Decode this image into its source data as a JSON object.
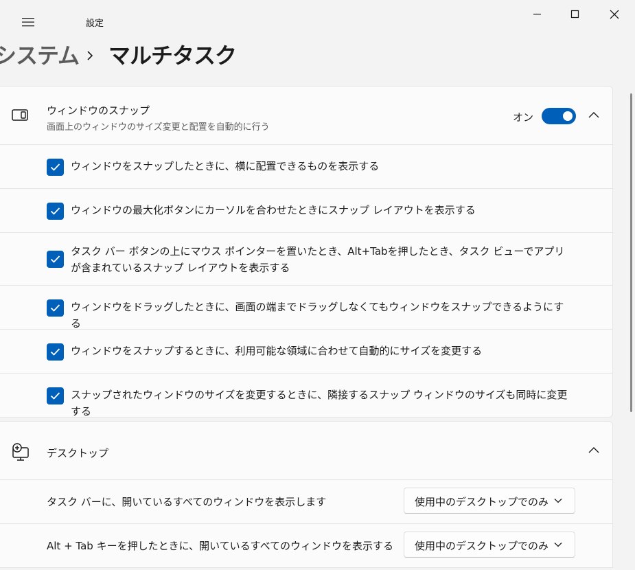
{
  "window": {
    "app_title": "設定"
  },
  "breadcrumb": {
    "parent": "システム",
    "separator": "›",
    "current": "マルチタスク"
  },
  "snap": {
    "title": "ウィンドウのスナップ",
    "subtitle": "画面上のウィンドウのサイズ変更と配置を自動的に行う",
    "toggle_label": "オン",
    "toggle_on": true,
    "options": [
      {
        "label": "ウィンドウをスナップしたときに、横に配置できるものを表示する",
        "checked": true
      },
      {
        "label": "ウィンドウの最大化ボタンにカーソルを合わせたときにスナップ レイアウトを表示する",
        "checked": true
      },
      {
        "label": "タスク バー ボタンの上にマウス ポインターを置いたとき、Alt+Tabを押したとき、タスク ビューでアプリが含まれているスナップ レイアウトを表示する",
        "checked": true
      },
      {
        "label": "ウィンドウをドラッグしたときに、画面の端までドラッグしなくてもウィンドウをスナップできるようにする",
        "checked": true
      },
      {
        "label": "ウィンドウをスナップするときに、利用可能な領域に合わせて自動的にサイズを変更する",
        "checked": true
      },
      {
        "label": "スナップされたウィンドウのサイズを変更するときに、隣接するスナップ ウィンドウのサイズも同時に変更する",
        "checked": true
      }
    ]
  },
  "desktop": {
    "title": "デスクトップ",
    "rows": [
      {
        "label": "タスク バーに、開いているすべてのウィンドウを表示します",
        "value": "使用中のデスクトップでのみ"
      },
      {
        "label": "Alt + Tab キーを押したときに、開いているすべてのウィンドウを表示する",
        "value": "使用中のデスクトップでのみ"
      }
    ]
  },
  "colors": {
    "accent": "#005fb8",
    "background": "#f3f3f3",
    "card": "#fbfbfb"
  }
}
